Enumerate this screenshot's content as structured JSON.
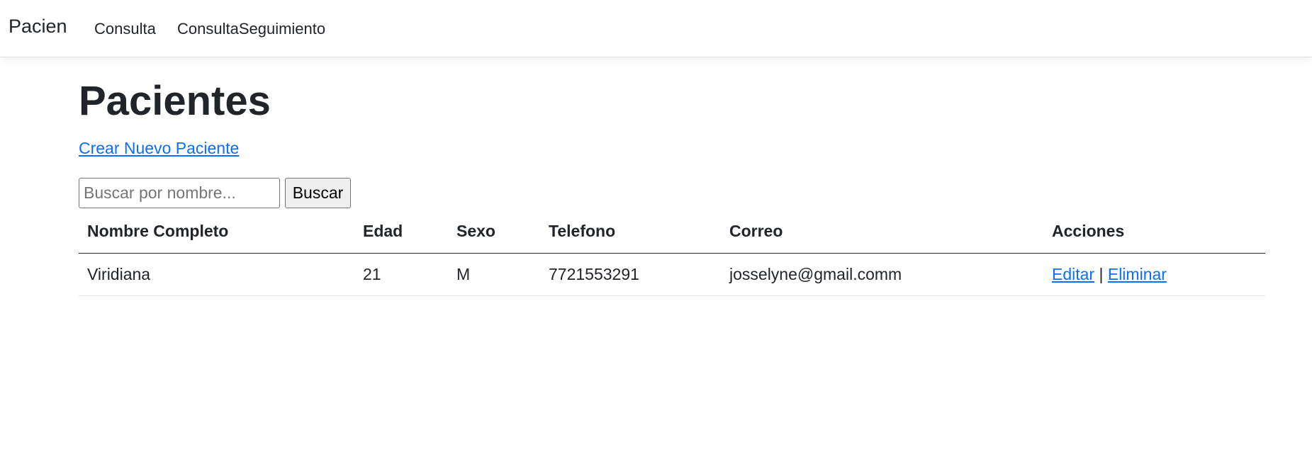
{
  "navbar": {
    "brand": "Pacien",
    "links": [
      {
        "label": "Consulta"
      },
      {
        "label": "ConsultaSeguimiento"
      }
    ]
  },
  "main": {
    "title": "Pacientes",
    "create_link": "Crear Nuevo Paciente",
    "search": {
      "placeholder": "Buscar por nombre...",
      "value": "",
      "button_label": "Buscar"
    },
    "table": {
      "headers": [
        "Nombre Completo",
        "Edad",
        "Sexo",
        "Telefono",
        "Correo",
        "Acciones"
      ],
      "rows": [
        {
          "nombre": "Viridiana",
          "edad": "21",
          "sexo": "M",
          "telefono": "7721553291",
          "correo": "josselyne@gmail.comm",
          "edit_label": "Editar",
          "separator": "|",
          "delete_label": "Eliminar"
        }
      ]
    }
  },
  "colors": {
    "link": "#0d6efd",
    "text": "#212529",
    "border": "#dee2e6"
  }
}
